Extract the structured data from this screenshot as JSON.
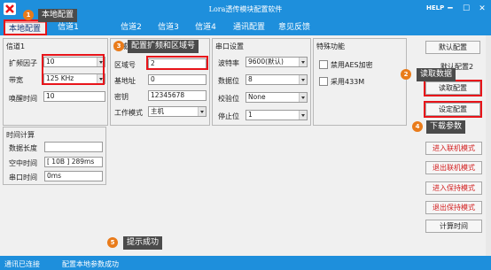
{
  "window": {
    "title": "Lora透传模块配置软件",
    "help": "HELP",
    "minimize": "━",
    "maximize": "☐",
    "close": "✕"
  },
  "tabs": [
    "本地配置",
    "信道1",
    "信道2",
    "信道3",
    "信道4",
    "通讯配置",
    "意见反馈"
  ],
  "channel1": {
    "title": "信道1",
    "spread_label": "扩频因子",
    "spread_value": "10",
    "bandwidth_label": "带宽",
    "bandwidth_value": "125 KHz",
    "wake_label": "唤醒时间",
    "wake_value": "10"
  },
  "area": {
    "title": "区域",
    "zone_label": "区域号",
    "zone_value": "2",
    "base_label": "基地址",
    "base_value": "0",
    "key_label": "密钥",
    "key_value": "12345678",
    "mode_label": "工作模式",
    "mode_value": "主机"
  },
  "serial": {
    "title": "串口设置",
    "baud_label": "波特率",
    "baud_value": "9600(默认)",
    "databits_label": "数据位",
    "databits_value": "8",
    "parity_label": "校验位",
    "parity_value": "None",
    "stopbits_label": "停止位",
    "stopbits_value": "1"
  },
  "features": {
    "title": "特殊功能",
    "aes_label": "禁用AES加密",
    "use433_label": "采用433M"
  },
  "timing": {
    "title": "时间计算",
    "datalen_label": "数据长度",
    "airtime_label": "空中时间",
    "airtime_value": "[ 10B ]    289ms",
    "serialtime_label": "串口时间",
    "serialtime_value": "0ms"
  },
  "buttons": {
    "default": "默认配置",
    "default2": "默认配置2",
    "read": "读取配置",
    "set": "设定配置",
    "enter_online": "进入联机模式",
    "exit_online": "退出联机模式",
    "enter_keep": "进入保持模式",
    "exit_keep": "退出保持模式",
    "calc_time": "计算时间"
  },
  "status": {
    "connection": "通讯已连接",
    "message": "配置本地参数成功"
  },
  "callouts": [
    {
      "num": "1",
      "text": "本地配置"
    },
    {
      "num": "2",
      "text": "读取数据"
    },
    {
      "num": "3",
      "text": "配置扩频和区域号"
    },
    {
      "num": "4",
      "text": "下载参数"
    },
    {
      "num": "5",
      "text": "提示成功"
    }
  ],
  "colors": {
    "accent": "#1e8fdc",
    "highlight": "#e8141a",
    "badge": "#e97b1a",
    "callout_bg": "#4b4b4b",
    "red_text": "#d21f1f"
  }
}
